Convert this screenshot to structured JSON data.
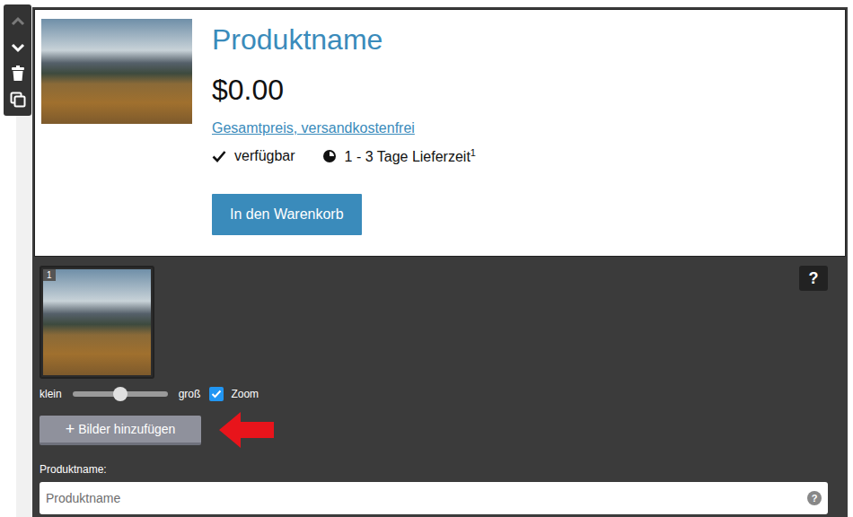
{
  "toolbar": {
    "buttons": [
      {
        "name": "move-up",
        "disabled": true
      },
      {
        "name": "move-down",
        "disabled": false
      },
      {
        "name": "delete",
        "disabled": false
      },
      {
        "name": "duplicate",
        "disabled": false
      }
    ]
  },
  "product": {
    "title": "Produktname",
    "price": "$0.00",
    "price_note": "Gesamtpreis, versandkostenfrei",
    "availability": "verfügbar",
    "delivery": "1 - 3 Tage Lieferzeit",
    "delivery_footnote": "1",
    "cart_button": "In den Warenkorb"
  },
  "editor": {
    "help_button": "?",
    "images": [
      {
        "index": "1"
      }
    ],
    "size_slider": {
      "min_label": "klein",
      "max_label": "groß",
      "level": 0.5
    },
    "zoom": {
      "label": "Zoom",
      "checked": true
    },
    "add_images_button": {
      "icon": "+",
      "label": "Bilder hinzufügen"
    },
    "name_field": {
      "label": "Produktname:",
      "placeholder": "Produktname",
      "value": "",
      "help": "?"
    }
  }
}
